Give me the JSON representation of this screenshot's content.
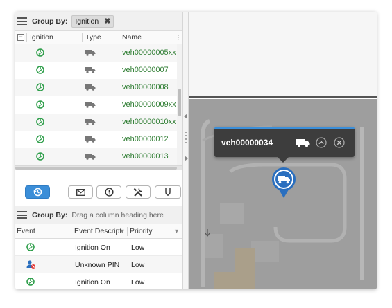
{
  "vehicles_panel": {
    "group_by": {
      "label": "Group By:",
      "chip": "Ignition",
      "chip_close": "✖"
    },
    "columns": {
      "ignition": "Ignition",
      "type": "Type",
      "name": "Name"
    },
    "rows": [
      {
        "name": "veh00000005xx"
      },
      {
        "name": "veh00000007"
      },
      {
        "name": "veh00000008"
      },
      {
        "name": "veh00000009xx"
      },
      {
        "name": "veh00000010xx"
      },
      {
        "name": "veh00000012"
      },
      {
        "name": "veh00000013"
      }
    ]
  },
  "toolbar": {
    "buttons": [
      "history-icon",
      "message-icon",
      "alert-icon",
      "tools-icon",
      "route-icon"
    ]
  },
  "events_panel": {
    "group_by": {
      "label": "Group By:",
      "placeholder": "Drag a column heading here"
    },
    "columns": {
      "event": "Event",
      "description": "Event Descript",
      "priority": "Priority"
    },
    "rows": [
      {
        "icon": "ignition-icon",
        "description": "Ignition On",
        "priority": "Low"
      },
      {
        "icon": "unknown-pin-icon",
        "description": "Unknown PIN",
        "priority": "Low"
      },
      {
        "icon": "ignition-icon",
        "description": "Ignition On",
        "priority": "Low"
      }
    ]
  },
  "map": {
    "popup": {
      "vehicle": "veh00000034"
    }
  },
  "colors": {
    "accent": "#3b8ed8",
    "ignition_green": "#2e9e4a",
    "vehicle_name_green": "#2e7d32",
    "popup_bg": "#3d3d3d",
    "map_bg": "#9d9d9d"
  }
}
